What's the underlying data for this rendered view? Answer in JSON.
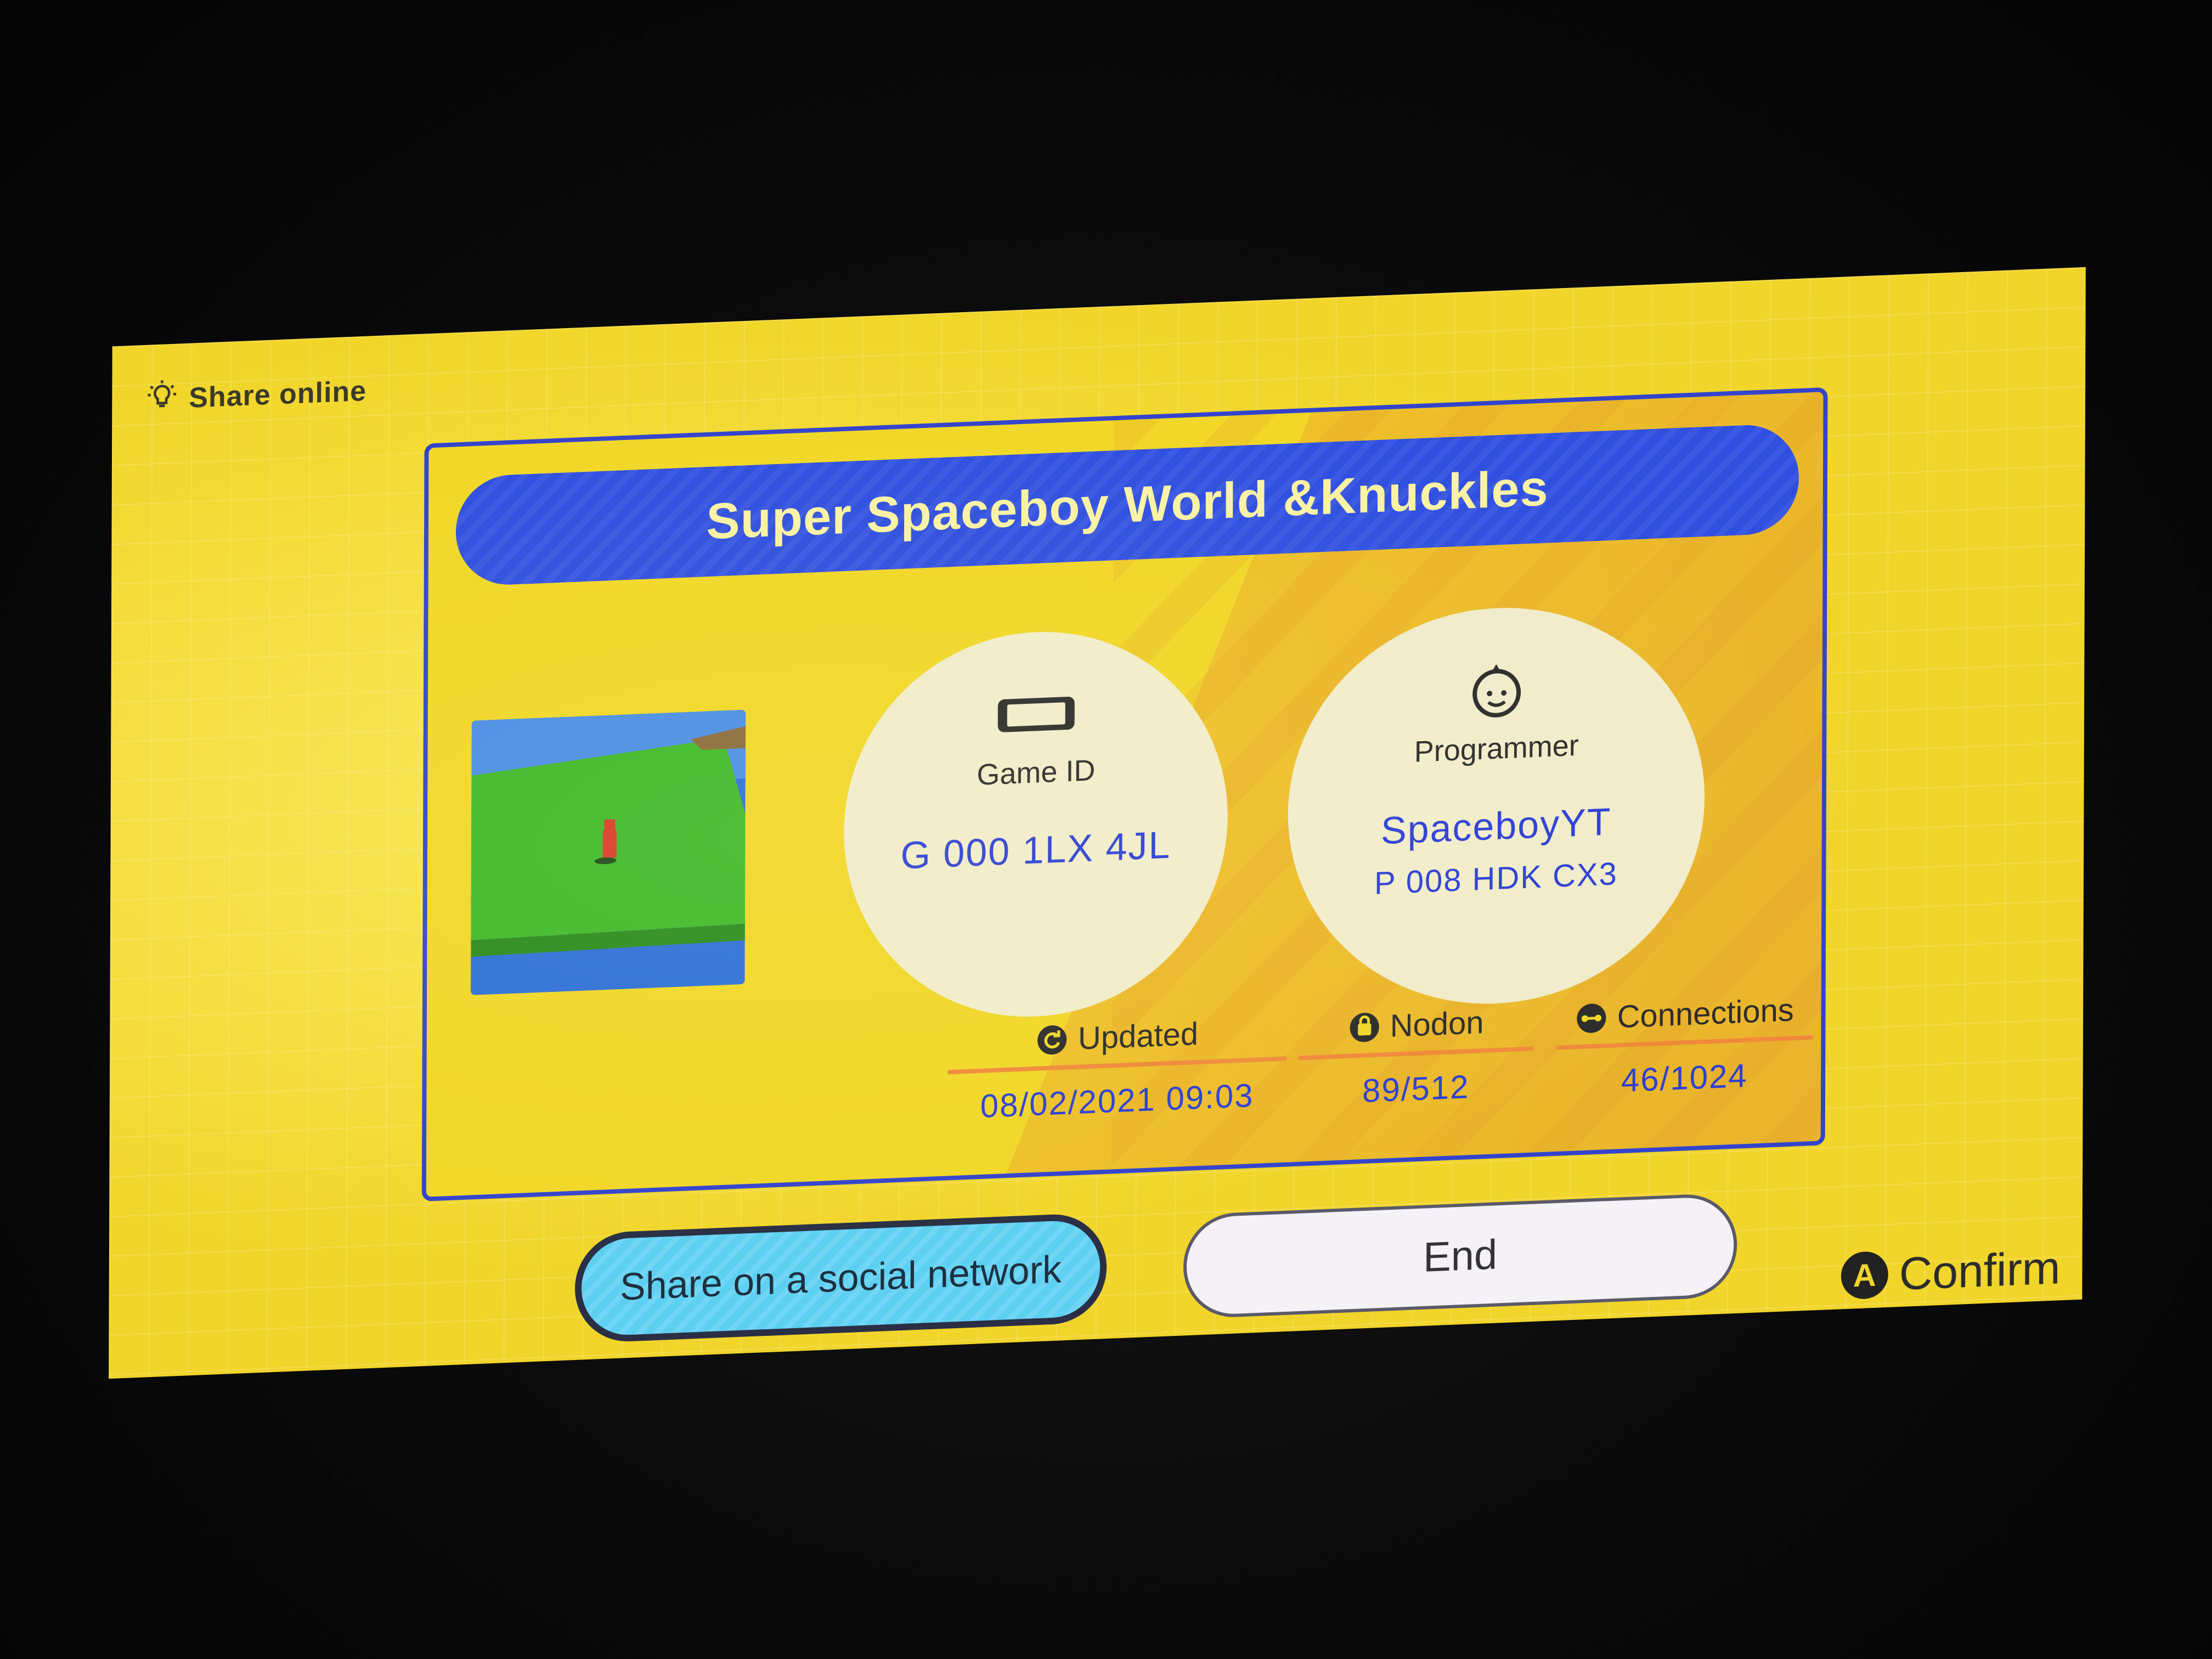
{
  "header": {
    "title": "Share online",
    "icon": "lightbulb-icon"
  },
  "game": {
    "title": "Super Spaceboy World &Knuckles",
    "game_id_label": "Game ID",
    "game_id": "G 000 1LX 4JL",
    "programmer_label": "Programmer",
    "programmer_name": "SpaceboyYT",
    "programmer_id": "P 008 HDK CX3"
  },
  "stats": {
    "updated_label": "Updated",
    "updated_value": "08/02/2021 09:03",
    "nodon_label": "Nodon",
    "nodon_value": "89/512",
    "connections_label": "Connections",
    "connections_value": "46/1024"
  },
  "buttons": {
    "share_label": "Share on a social network",
    "end_label": "End"
  },
  "footer": {
    "confirm_button": "A",
    "confirm_label": "Confirm"
  },
  "colors": {
    "background_yellow": "#f1d52a",
    "title_blue": "#2f4fe0",
    "value_blue": "#2c3fd6",
    "share_button_cyan": "#5dd0f2",
    "stat_underline_orange": "#f08a3a"
  }
}
